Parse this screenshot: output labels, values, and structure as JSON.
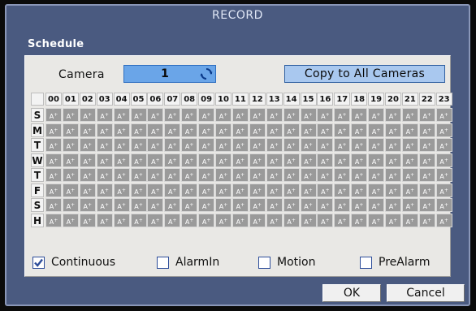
{
  "window": {
    "title": "RECORD"
  },
  "section": {
    "label": "Schedule"
  },
  "camera": {
    "label": "Camera",
    "value": "1",
    "icon": "refresh-icon"
  },
  "copy_button": {
    "label": "Copy to All Cameras"
  },
  "schedule": {
    "hours": [
      "00",
      "01",
      "02",
      "03",
      "04",
      "05",
      "06",
      "07",
      "08",
      "09",
      "10",
      "11",
      "12",
      "13",
      "14",
      "15",
      "16",
      "17",
      "18",
      "19",
      "20",
      "21",
      "22",
      "23"
    ],
    "days": [
      "S",
      "M",
      "T",
      "W",
      "T",
      "F",
      "S",
      "H"
    ],
    "cell_label": "A",
    "cell_mark": "+"
  },
  "modes": [
    {
      "label": "Continuous",
      "checked": true
    },
    {
      "label": "AlarmIn",
      "checked": false
    },
    {
      "label": "Motion",
      "checked": false
    },
    {
      "label": "PreAlarm",
      "checked": false
    }
  ],
  "buttons": {
    "ok": "OK",
    "cancel": "Cancel"
  },
  "colors": {
    "window_bg": "#4a5a80",
    "panel_bg": "#e9e8e5",
    "camera_field": "#6aa5e8",
    "copy_button": "#a9c8ef",
    "cell_bg": "#9a9a9a",
    "checkbox_check": "#2d4d9a"
  }
}
